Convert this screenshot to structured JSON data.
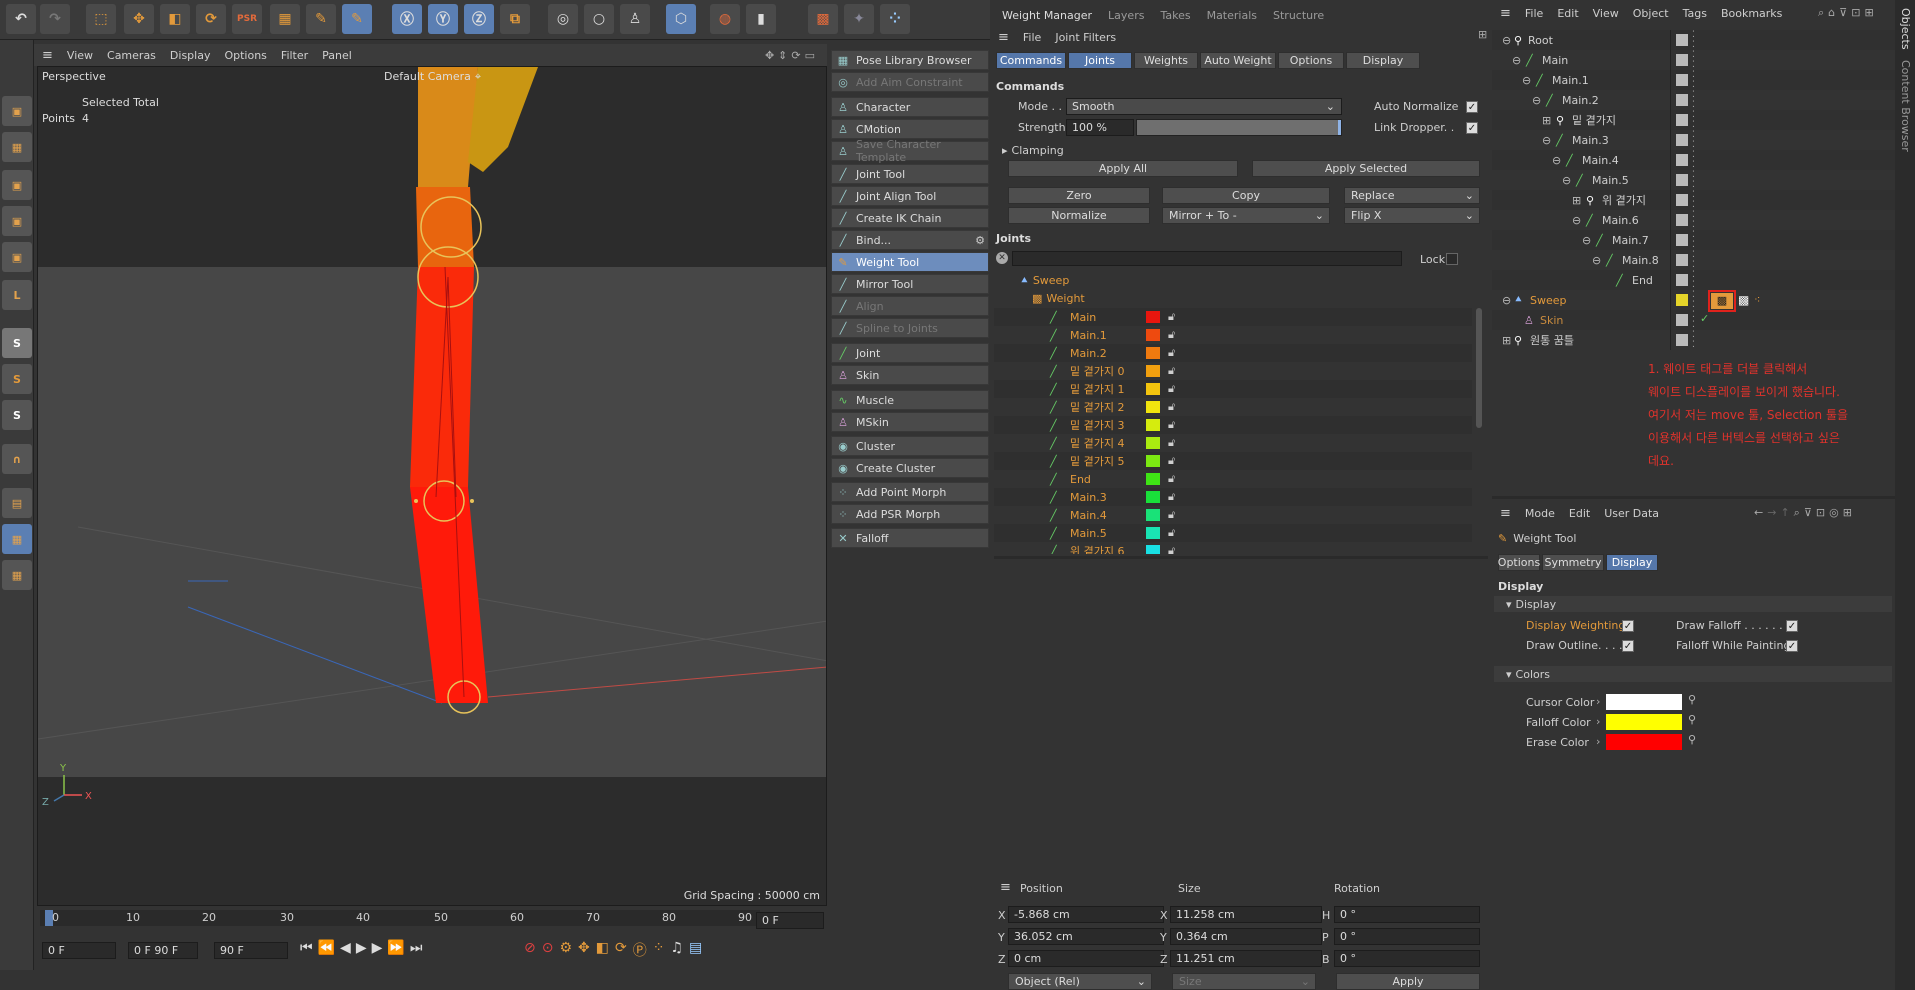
{
  "viewport": {
    "menu": [
      "View",
      "Cameras",
      "Display",
      "Options",
      "Filter",
      "Panel"
    ],
    "label": "Perspective",
    "camera": "Default Camera",
    "selected_total": "Selected Total",
    "points_label": "Points",
    "points_value": "4",
    "grid_spacing": "Grid Spacing : 50000 cm"
  },
  "timeline": {
    "ticks": [
      "0",
      "10",
      "20",
      "30",
      "40",
      "50",
      "60",
      "70",
      "80",
      "90"
    ],
    "current_frame": "0 F",
    "start_frame": "0 F",
    "range_display": "0 F   90 F",
    "end_frame": "90 F"
  },
  "palette": {
    "items": [
      {
        "label": "Pose Library Browser",
        "state": "normal"
      },
      {
        "label": "Add Aim Constraint",
        "state": "disabled"
      },
      {
        "label": "Character",
        "state": "normal"
      },
      {
        "label": "CMotion",
        "state": "normal"
      },
      {
        "label": "Save Character Template",
        "state": "disabled"
      },
      {
        "label": "Joint Tool",
        "state": "normal"
      },
      {
        "label": "Joint Align Tool",
        "state": "normal"
      },
      {
        "label": "Create IK Chain",
        "state": "normal"
      },
      {
        "label": "Bind...",
        "state": "normal"
      },
      {
        "label": "Weight Tool",
        "state": "selected"
      },
      {
        "label": "Mirror Tool",
        "state": "normal"
      },
      {
        "label": "Align",
        "state": "disabled"
      },
      {
        "label": "Spline to Joints",
        "state": "disabled"
      },
      {
        "label": "Joint",
        "state": "normal"
      },
      {
        "label": "Skin",
        "state": "normal"
      },
      {
        "label": "Muscle",
        "state": "normal"
      },
      {
        "label": "MSkin",
        "state": "normal"
      },
      {
        "label": "Cluster",
        "state": "normal"
      },
      {
        "label": "Create Cluster",
        "state": "normal"
      },
      {
        "label": "Add Point Morph",
        "state": "normal"
      },
      {
        "label": "Add PSR Morph",
        "state": "normal"
      },
      {
        "label": "Falloff",
        "state": "normal"
      }
    ]
  },
  "weight_manager": {
    "tabs": [
      "Weight Manager",
      "Layers",
      "Takes",
      "Materials",
      "Structure"
    ],
    "menu": [
      "File",
      "Joint Filters"
    ],
    "subtabs": [
      "Commands",
      "Joints",
      "Weights",
      "Auto Weight",
      "Options",
      "Display"
    ],
    "commands_heading": "Commands",
    "mode_label": "Mode . .",
    "mode_value": "Smooth",
    "strength_label": "Strength",
    "strength_value": "100 %",
    "auto_normalize": "Auto Normalize",
    "link_dropper": "Link Dropper. .",
    "clamping": "Clamping",
    "apply_all": "Apply All",
    "apply_selected": "Apply Selected",
    "zero": "Zero",
    "copy": "Copy",
    "replace": "Replace",
    "normalize": "Normalize",
    "mirror": "Mirror + To -",
    "flip": "Flip X",
    "joints_heading": "Joints",
    "lock": "Lock",
    "tree_sweep": "Sweep",
    "tree_weight": "Weight",
    "joints": [
      {
        "name": "Main",
        "color": "#e8160e"
      },
      {
        "name": "Main.1",
        "color": "#ee4a0f"
      },
      {
        "name": "Main.2",
        "color": "#f07a0f"
      },
      {
        "name": "밑 곁가지 0",
        "color": "#f2a00f"
      },
      {
        "name": "밑 곁가지 1",
        "color": "#f3c40e"
      },
      {
        "name": "밑 곁가지 2",
        "color": "#f1e40e"
      },
      {
        "name": "밑 곁가지 3",
        "color": "#d5ec0e"
      },
      {
        "name": "밑 곁가지 4",
        "color": "#aaec10"
      },
      {
        "name": "밑 곁가지 5",
        "color": "#7ce812"
      },
      {
        "name": "End",
        "color": "#3fe415"
      },
      {
        "name": "Main.3",
        "color": "#19e03a"
      },
      {
        "name": "Main.4",
        "color": "#19e278"
      },
      {
        "name": "Main.5",
        "color": "#19e4b4"
      },
      {
        "name": "위 곁가지 6",
        "color": "#19e0e4"
      }
    ]
  },
  "coords": {
    "headers": [
      "Position",
      "Size",
      "Rotation"
    ],
    "rows": [
      {
        "a": "X",
        "pos": "-5.868 cm",
        "b": "X",
        "size": "11.258 cm",
        "c": "H",
        "rot": "0 °"
      },
      {
        "a": "Y",
        "pos": "36.052 cm",
        "b": "Y",
        "size": "0.364 cm",
        "c": "P",
        "rot": "0 °"
      },
      {
        "a": "Z",
        "pos": "0 cm",
        "b": "Z",
        "size": "11.251 cm",
        "c": "B",
        "rot": "0 °"
      }
    ],
    "mode": "Object (Rel)",
    "size_mode": "Size",
    "apply": "Apply"
  },
  "object_manager": {
    "menu": [
      "File",
      "Edit",
      "View",
      "Object",
      "Tags",
      "Bookmarks"
    ],
    "rows": [
      {
        "name": "Root",
        "indent": 0,
        "kind": "null"
      },
      {
        "name": "Main",
        "indent": 1,
        "kind": "joint"
      },
      {
        "name": "Main.1",
        "indent": 2,
        "kind": "joint"
      },
      {
        "name": "Main.2",
        "indent": 3,
        "kind": "joint"
      },
      {
        "name": "밑 곁가지",
        "indent": 4,
        "kind": "null"
      },
      {
        "name": "Main.3",
        "indent": 4,
        "kind": "joint"
      },
      {
        "name": "Main.4",
        "indent": 5,
        "kind": "joint"
      },
      {
        "name": "Main.5",
        "indent": 6,
        "kind": "joint"
      },
      {
        "name": "위 곁가지",
        "indent": 7,
        "kind": "null"
      },
      {
        "name": "Main.6",
        "indent": 7,
        "kind": "joint"
      },
      {
        "name": "Main.7",
        "indent": 8,
        "kind": "joint"
      },
      {
        "name": "Main.8",
        "indent": 9,
        "kind": "joint"
      },
      {
        "name": "End",
        "indent": 10,
        "kind": "joint"
      },
      {
        "name": "Sweep",
        "indent": 0,
        "kind": "sweep"
      },
      {
        "name": "Skin",
        "indent": 1,
        "kind": "skin"
      },
      {
        "name": "원통 꿈틀",
        "indent": 0,
        "kind": "null"
      }
    ],
    "note": "1. 웨이트 태그를 더블 클릭해서\n웨이트 디스플레이를 보이게 했습니다.\n여기서 저는 move 툴, Selection 툴을\n이용해서 다른 버텍스를 선택하고 싶은\n데요."
  },
  "attribute_manager": {
    "menu": [
      "Mode",
      "Edit",
      "User Data"
    ],
    "title": "Weight Tool",
    "tabs": [
      "Options",
      "Symmetry",
      "Display"
    ],
    "section": "Display",
    "group_display": "Display",
    "display_weighting": "Display Weighting",
    "draw_falloff": "Draw Falloff . . . . . .",
    "draw_outline": "Draw Outline. . . .",
    "falloff_painting": "Falloff While Painting",
    "group_colors": "Colors",
    "cursor_color": "Cursor Color",
    "falloff_color": "Falloff Color",
    "erase_color": "Erase Color",
    "colors": {
      "cursor": "#ffffff",
      "falloff": "#ffff00",
      "erase": "#ff0000"
    }
  },
  "side_tabs": [
    "Objects",
    "Content Browser"
  ]
}
